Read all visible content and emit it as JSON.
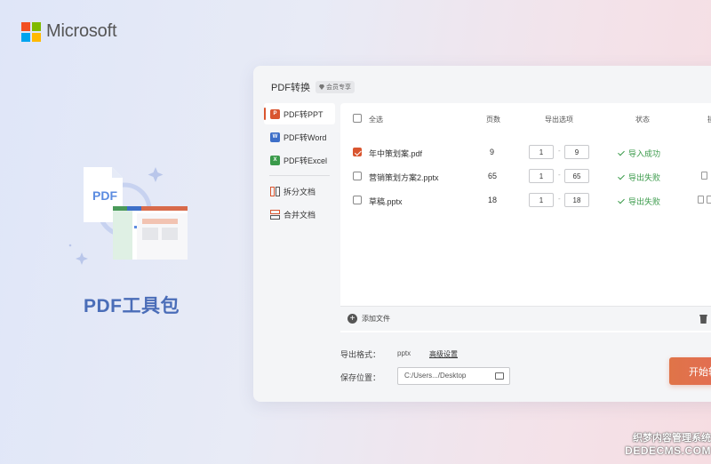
{
  "brand": {
    "name": "Microsoft",
    "colors": [
      "#f25022",
      "#7fba00",
      "#00a4ef",
      "#ffb900"
    ]
  },
  "hero": {
    "title": "PDF工具包",
    "doc_label": "PDF"
  },
  "panel": {
    "title": "PDF转换",
    "vip_badge": "会员专享",
    "sidebar": [
      {
        "label": "PDF转PPT",
        "icon": "ppt-icon",
        "active": true
      },
      {
        "label": "PDF转Word",
        "icon": "word-icon",
        "active": false
      },
      {
        "label": "PDF转Excel",
        "icon": "excel-icon",
        "active": false
      },
      {
        "label": "拆分文档",
        "icon": "split-icon",
        "active": false
      },
      {
        "label": "合并文档",
        "icon": "merge-icon",
        "active": false
      }
    ],
    "table": {
      "select_all": "全选",
      "col_pages": "页数",
      "col_range": "导出选项",
      "col_status": "状态",
      "col_action": "操",
      "rows": [
        {
          "checked": true,
          "name": "年中策划案.pdf",
          "pages": "9",
          "from": "1",
          "to": "9",
          "status": "导入成功"
        },
        {
          "checked": false,
          "name": "营销策划方案2.pptx",
          "pages": "65",
          "from": "1",
          "to": "65",
          "status": "导出失败"
        },
        {
          "checked": false,
          "name": "草稿.pptx",
          "pages": "18",
          "from": "1",
          "to": "18",
          "status": "导出失败"
        }
      ],
      "range_sep": "-"
    },
    "add_file": "添加文件",
    "export_format_label": "导出格式：",
    "export_format_value": "pptx",
    "advanced_settings": "高级设置",
    "save_location_label": "保存位置：",
    "save_location_value": "C:/Users.../Desktop",
    "start_button": "开始转",
    "accent_color": "#d9552f",
    "success_color": "#3a9a4a"
  },
  "watermark": {
    "line1": "织梦内容管理系统",
    "line2": "DEDECMS.COM"
  }
}
